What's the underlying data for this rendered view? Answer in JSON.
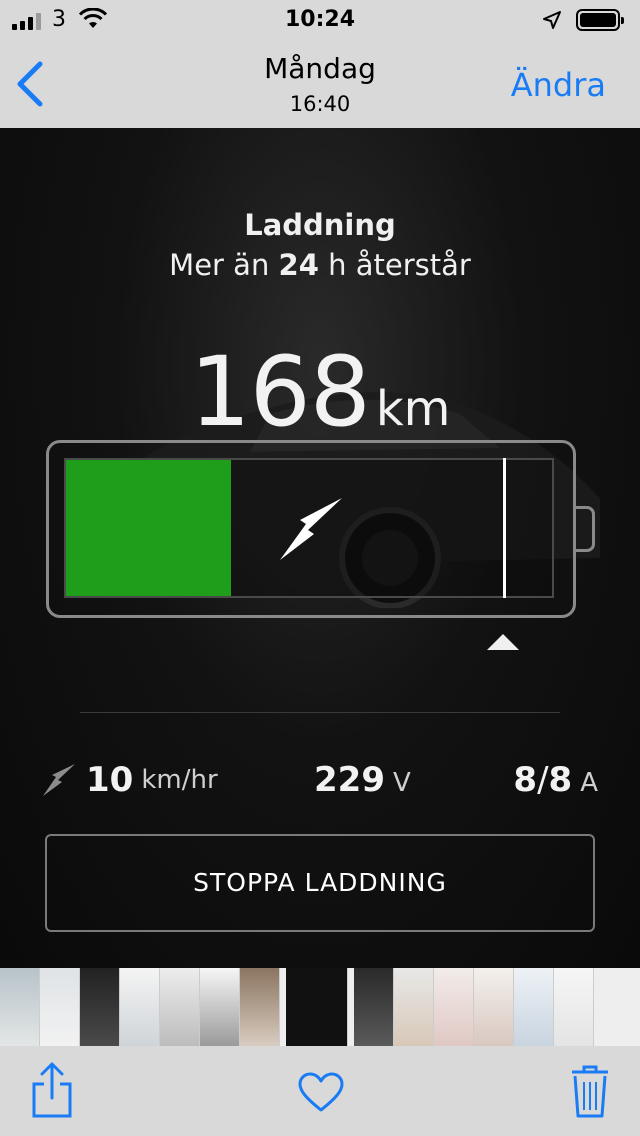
{
  "status_bar": {
    "carrier": "3",
    "time": "10:24",
    "icons": [
      "signal-icon",
      "wifi-icon",
      "location-icon",
      "battery-icon"
    ]
  },
  "nav": {
    "title": "Måndag",
    "subtitle": "16:40",
    "edit_label": "Ändra",
    "back_icon": "chevron-left-icon",
    "accent_color": "#1a7cf5"
  },
  "charging": {
    "headline": "Laddning",
    "remaining_prefix": "Mer än ",
    "remaining_bold": "24",
    "remaining_suffix": " h återstår",
    "range_value": "168",
    "range_unit": "km",
    "charge_level": 0.34,
    "charge_limit": 0.9,
    "charge_color": "#1f9e1b",
    "rate_value": "10",
    "rate_unit": "km/hr",
    "voltage_value": "229",
    "voltage_unit": "V",
    "current_value": "8",
    "current_sep": "/",
    "current_max": "8",
    "current_unit": "A",
    "stop_label": "STOPPA LADDNING"
  },
  "toolbar": {
    "icons": [
      "share-icon",
      "heart-icon",
      "trash-icon"
    ]
  }
}
